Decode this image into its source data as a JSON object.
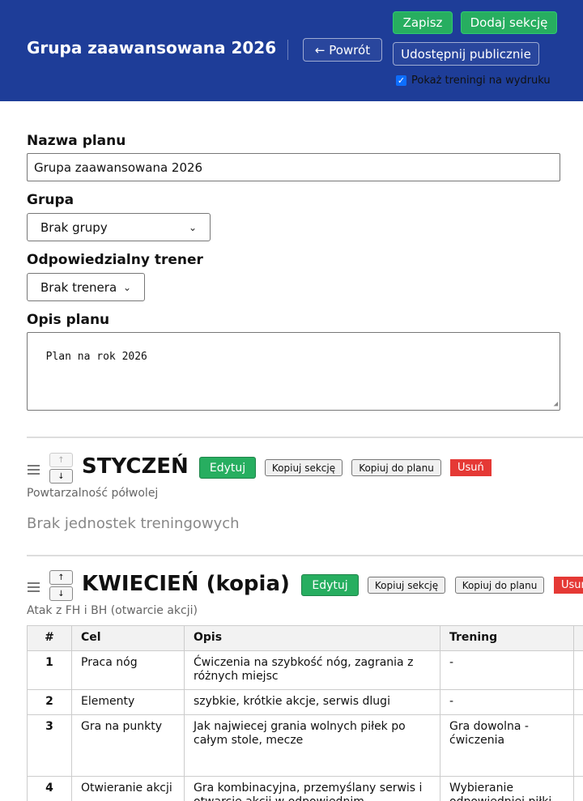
{
  "header": {
    "title": "Grupa zaawansowana 2026",
    "back_label": "← Powrót",
    "save_label": "Zapisz",
    "add_section_label": "Dodaj sekcję",
    "share_label": "Udostępnij publicznie",
    "print_toggle_label": "Pokaż treningi na wydruku",
    "print_toggle_checked": true
  },
  "form": {
    "name_label": "Nazwa planu",
    "name_value": "Grupa zaawansowana 2026",
    "group_label": "Grupa",
    "group_selected": "Brak grupy",
    "coach_label": "Odpowiedzialny trener",
    "coach_selected": "Brak trenera",
    "description_label": "Opis planu",
    "description_value": "Plan na rok 2026"
  },
  "sections": [
    {
      "title": "STYCZEŃ",
      "subtitle": "Powtarzalność półwolej",
      "edit_label": "Edytuj",
      "copy_section_label": "Kopiuj sekcję",
      "copy_to_plan_label": "Kopiuj do planu",
      "delete_label": "Usuń",
      "empty_text": "Brak jednostek treningowych"
    },
    {
      "title": "KWIECIEŃ (kopia)",
      "subtitle": "Atak z FH i BH (otwarcie akcji)",
      "edit_label": "Edytuj",
      "copy_section_label": "Kopiuj sekcję",
      "copy_to_plan_label": "Kopiuj do planu",
      "delete_label": "Usuń",
      "table": {
        "columns": [
          "#",
          "Cel",
          "Opis",
          "Trening"
        ],
        "rows": [
          {
            "num": "1",
            "goal": "Praca nóg",
            "desc": "Ćwiczenia na szybkość nóg, zagrania z różnych miejsc",
            "training": "-"
          },
          {
            "num": "2",
            "goal": "Elementy",
            "desc": "szybkie, krótkie akcje, serwis dlugi",
            "training": "-"
          },
          {
            "num": "3",
            "goal": "Gra na punkty",
            "desc": "Jak najwiecej grania wolnych piłek po całym stole, mecze",
            "training": "Gra dowolna - ćwiczenia"
          },
          {
            "num": "4",
            "goal": "Otwieranie akcji",
            "desc": "Gra kombinacyjna, przemyślany serwis i otwarcie akcji w odpowiednim",
            "training": "Wybieranie odpowiedniej piłki"
          }
        ]
      }
    }
  ],
  "colors": {
    "header_bg": "#1e3d98",
    "success": "#27ae60",
    "danger": "#e53935"
  }
}
